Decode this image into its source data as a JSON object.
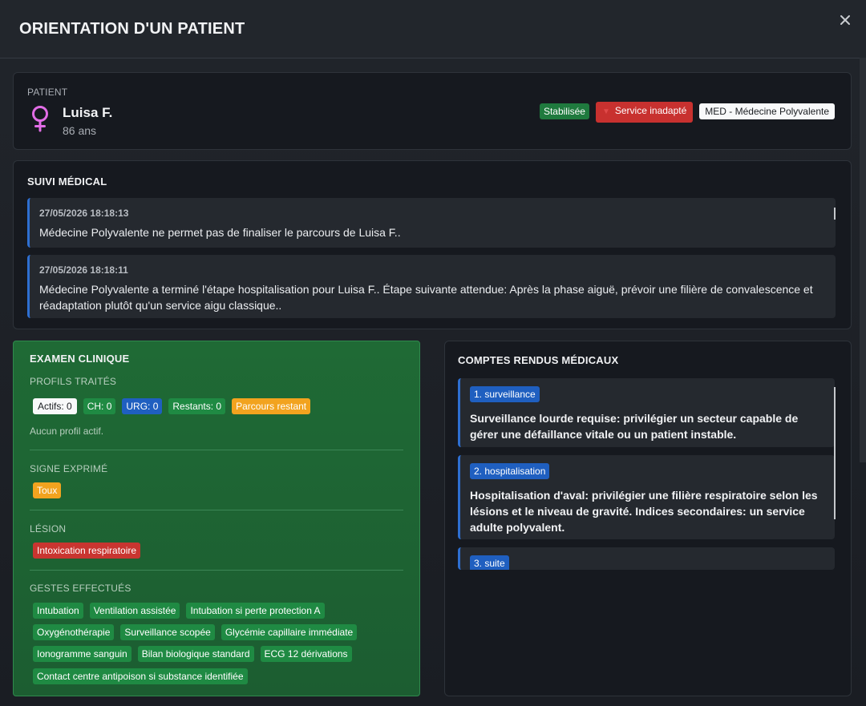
{
  "header": {
    "title": "ORIENTATION D'UN PATIENT",
    "close_icon": "close-icon"
  },
  "patient": {
    "label": "PATIENT",
    "name": "Luisa F.",
    "age": "86 ans",
    "sex_icon": "female-icon",
    "badges": {
      "state": "Stabilisée",
      "service_warning": "Service inadapté",
      "service": "MED - Médecine Polyvalente"
    },
    "colors": {
      "female": "#e26de6",
      "green": "#1f7a3e",
      "red": "#c8312f"
    }
  },
  "suivi": {
    "title": "SUIVI MÉDICAL",
    "entries": [
      {
        "time": "27/05/2026 18:18:13",
        "text": "Médecine Polyvalente ne permet pas de finaliser le parcours de Luisa F.."
      },
      {
        "time": "27/05/2026 18:18:11",
        "text": "Médecine Polyvalente a terminé l'étape hospitalisation pour Luisa F.. Étape suivante attendue: Après la phase aiguë, prévoir une filière de convalescence et réadaptation plutôt qu'un service aigu classique.."
      }
    ]
  },
  "exam": {
    "title": "EXAMEN CLINIQUE",
    "profils_label": "PROFILS TRAITÉS",
    "profils": {
      "actifs": "Actifs: 0",
      "ch": "CH: 0",
      "urg": "URG: 0",
      "restants": "Restants: 0",
      "parcours": "Parcours restant"
    },
    "no_profile": "Aucun profil actif.",
    "signe_label": "SIGNE EXPRIMÉ",
    "signe": "Toux",
    "lesion_label": "LÉSION",
    "lesion": "Intoxication respiratoire",
    "gestes_label": "GESTES EFFECTUÉS",
    "gestes": [
      "Intubation",
      "Ventilation assistée",
      "Intubation si perte protection A",
      "Oxygénothérapie",
      "Surveillance scopée",
      "Glycémie capillaire immédiate",
      "Ionogramme sanguin",
      "Bilan biologique standard",
      "ECG 12 dérivations",
      "Contact centre antipoison si substance identifiée"
    ]
  },
  "reports": {
    "title": "COMPTES RENDUS MÉDICAUX",
    "items": [
      {
        "tag": "1. surveillance",
        "text": "Surveillance lourde requise: privilégier un secteur capable de gérer une défaillance vitale ou un patient instable."
      },
      {
        "tag": "2. hospitalisation",
        "text": "Hospitalisation d'aval: privilégier une filière respiratoire selon les lésions et le niveau de gravité. Indices secondaires: un service adulte polyvalent."
      },
      {
        "tag": "3. suite",
        "text": ""
      }
    ]
  }
}
